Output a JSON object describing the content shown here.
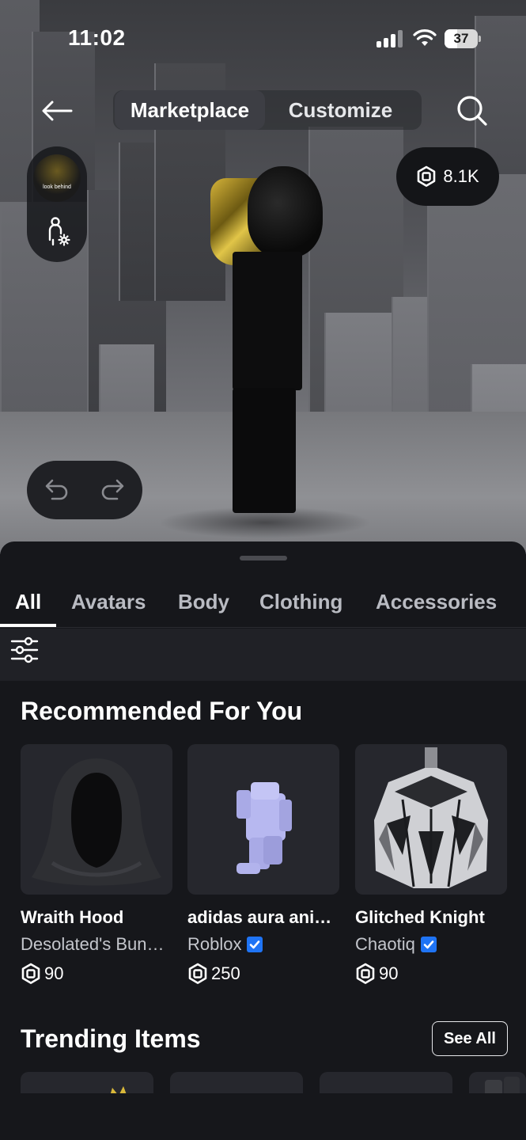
{
  "status_bar": {
    "time": "11:02",
    "battery": "37"
  },
  "top_nav": {
    "tabs": [
      {
        "label": "Marketplace",
        "active": true
      },
      {
        "label": "Customize",
        "active": false
      }
    ]
  },
  "avatar_pill": {
    "thumbnail_text": "look behind"
  },
  "robux_balance": "8.1K",
  "categories": [
    {
      "label": "All",
      "active": true
    },
    {
      "label": "Avatars",
      "active": false
    },
    {
      "label": "Body",
      "active": false
    },
    {
      "label": "Clothing",
      "active": false
    },
    {
      "label": "Accessories",
      "active": false
    }
  ],
  "recommended": {
    "title": "Recommended For You",
    "items": [
      {
        "name": "Wraith Hood",
        "creator": "Desolated's Bun…",
        "verified": false,
        "price": "90"
      },
      {
        "name": "adidas aura ani…",
        "creator": "Roblox",
        "verified": true,
        "price": "250"
      },
      {
        "name": "Glitched Knight",
        "creator": "Chaotiq",
        "verified": true,
        "price": "90"
      }
    ]
  },
  "trending": {
    "title": "Trending Items",
    "see_all_label": "See All"
  },
  "icons": {
    "back": "arrow-left-icon",
    "search": "search-icon",
    "robux": "robux-icon",
    "undo": "undo-icon",
    "redo": "redo-icon",
    "filter": "filter-sliders-icon",
    "verified": "verified-badge-icon",
    "avatar_edit": "avatar-settings-icon"
  },
  "colors": {
    "accent_verified": "#1f74f5",
    "sheet_bg": "#16171b",
    "card_bg": "#26272d"
  }
}
